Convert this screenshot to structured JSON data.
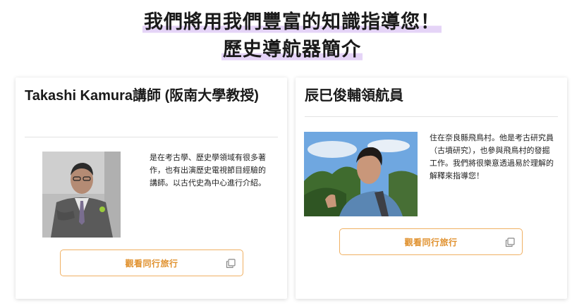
{
  "heading": {
    "line1": "我們將用我們豐富的知識指導您！",
    "line2": "歷史導航器簡介"
  },
  "guides": [
    {
      "name": "Takashi Kamura講師 (阪南大學教授)",
      "bio": "是在考古學、歷史學領域有很多著作，也有出演歷史電視節目經驗的講師。以古代史為中心進行介紹。",
      "button_label": "觀看同行旅行"
    },
    {
      "name": "辰巳俊輔領航員",
      "bio": "住在奈良縣飛鳥村。他是考古研究員（古墳研究），也參與飛鳥村的發掘工作。我們將很樂意透過易於理解的解釋來指導您！",
      "button_label": "觀看同行旅行"
    }
  ],
  "colors": {
    "accent": "#e0912e",
    "button_border": "#f0b063",
    "highlight": "#e5d4f7"
  },
  "icons": {
    "button_icon": "copy-icon"
  }
}
